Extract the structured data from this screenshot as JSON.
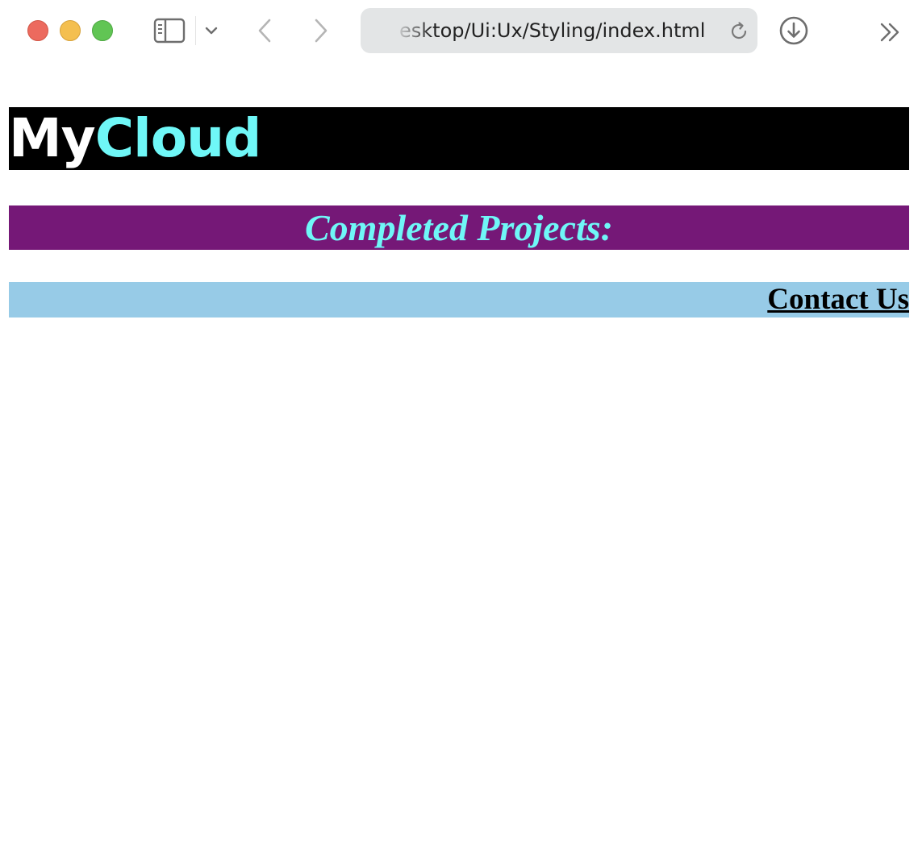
{
  "browser": {
    "url_display": "esktop/Ui:Ux/Styling/index.html",
    "buttons": {
      "close": "close-window",
      "minimize": "minimize-window",
      "zoom": "zoom-window",
      "sidebar": "sidebar-icon",
      "tab_group_menu": "chevron-down-icon",
      "back": "chevron-left-icon",
      "forward": "chevron-right-icon",
      "reload": "reload-icon",
      "downloads": "download-icon",
      "more": "double-chevron-right-icon"
    }
  },
  "page": {
    "logo_part1": "My",
    "logo_part2": "Cloud",
    "projects_heading": "Completed Projects:",
    "contact_link": "Contact Us"
  },
  "colors": {
    "header_bg": "#000000",
    "logo_accent": "#6ff7f7",
    "projects_bg": "#751877",
    "contact_bg": "#97cbe7"
  }
}
